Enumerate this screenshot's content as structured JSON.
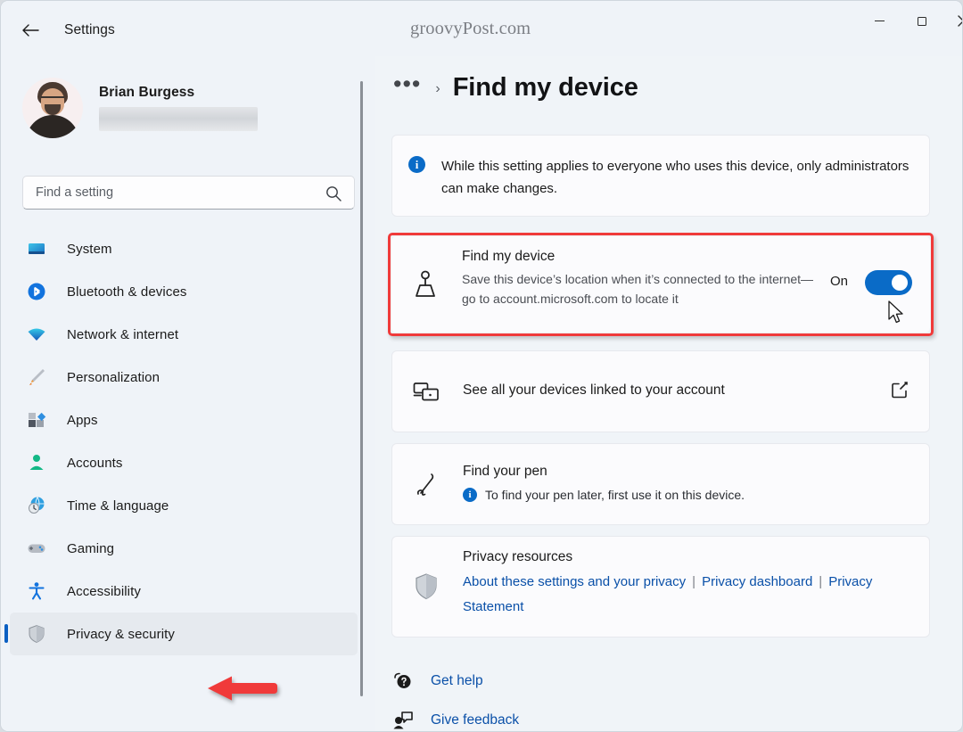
{
  "window": {
    "title": "Settings",
    "watermark": "groovyPost.com",
    "controls": {
      "minimize": "minimize-button",
      "maximize": "maximize-button",
      "close": "close-button"
    }
  },
  "sidebar": {
    "profile": {
      "name": "Brian Burgess",
      "email_redacted": true
    },
    "search": {
      "placeholder": "Find a setting",
      "value": ""
    },
    "items": [
      {
        "label": "System",
        "icon": "monitor-icon",
        "selected": false
      },
      {
        "label": "Bluetooth & devices",
        "icon": "bluetooth-icon",
        "selected": false
      },
      {
        "label": "Network & internet",
        "icon": "wifi-icon",
        "selected": false
      },
      {
        "label": "Personalization",
        "icon": "paintbrush-icon",
        "selected": false
      },
      {
        "label": "Apps",
        "icon": "apps-icon",
        "selected": false
      },
      {
        "label": "Accounts",
        "icon": "person-icon",
        "selected": false
      },
      {
        "label": "Time & language",
        "icon": "globe-clock-icon",
        "selected": false
      },
      {
        "label": "Gaming",
        "icon": "gamepad-icon",
        "selected": false
      },
      {
        "label": "Accessibility",
        "icon": "accessibility-icon",
        "selected": false
      },
      {
        "label": "Privacy & security",
        "icon": "shield-icon",
        "selected": true
      }
    ]
  },
  "content": {
    "breadcrumb_dots": "•••",
    "breadcrumb_chevron": "›",
    "title": "Find my device",
    "info_banner": {
      "icon": "info-icon",
      "text": "While this setting applies to everyone who uses this device, only administrators can make changes."
    },
    "find_my_device": {
      "icon": "find-device-icon",
      "title": "Find my device",
      "description": "Save this device’s location when it’s connected to the internet—go to account.microsoft.com to locate it",
      "toggle_label": "On",
      "toggle_state": "on",
      "highlighted": true
    },
    "linked_devices": {
      "icon": "devices-icon",
      "label": "See all your devices linked to your account",
      "external_link_icon": "external-link-icon"
    },
    "find_your_pen": {
      "icon": "pen-icon",
      "title": "Find your pen",
      "info_icon": "info-icon",
      "subtext": "To find your pen later, first use it on this device."
    },
    "privacy_resources": {
      "icon": "shield-icon",
      "title": "Privacy resources",
      "links": [
        "About these settings and your privacy",
        "Privacy dashboard",
        "Privacy Statement"
      ],
      "separator": "|"
    },
    "footer_links": [
      {
        "label": "Get help",
        "icon": "help-icon"
      },
      {
        "label": "Give feedback",
        "icon": "feedback-icon"
      }
    ]
  },
  "annotations": {
    "arrow_color": "#f03a3a",
    "highlight_color": "#f03a3a",
    "target": "Privacy & security"
  },
  "colors": {
    "accent": "#0a6bc7",
    "link": "#0a50a8",
    "sidebar_bg": "#eff3f8",
    "content_bg": "#f0f4f8",
    "card_bg": "#fbfbfd"
  }
}
